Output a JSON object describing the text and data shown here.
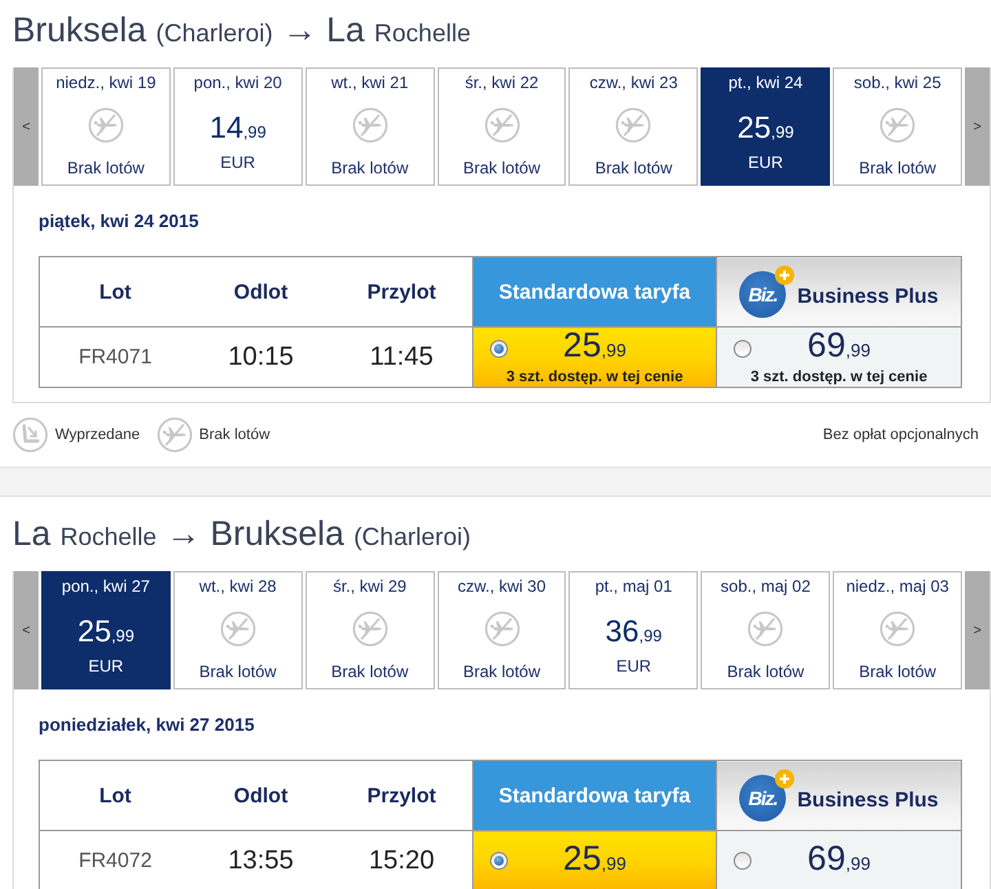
{
  "journeys": [
    {
      "title": {
        "origin": {
          "large": "Bruksela",
          "small": "(Charleroi)"
        },
        "arrow": "→",
        "destination": {
          "large": "La",
          "small": "Rochelle"
        }
      },
      "date_strip": {
        "prev": "<",
        "next": ">",
        "days": [
          {
            "label": "niedz., kwi 19",
            "kind": "no_flights",
            "status": "Brak lotów",
            "selected": false
          },
          {
            "label": "pon., kwi 20",
            "kind": "price",
            "price": {
              "whole": "14",
              "fraction": ",99"
            },
            "currency": "EUR",
            "selected": false
          },
          {
            "label": "wt., kwi 21",
            "kind": "no_flights",
            "status": "Brak lotów",
            "selected": false
          },
          {
            "label": "śr., kwi 22",
            "kind": "no_flights",
            "status": "Brak lotów",
            "selected": false
          },
          {
            "label": "czw., kwi 23",
            "kind": "no_flights",
            "status": "Brak lotów",
            "selected": false
          },
          {
            "label": "pt., kwi 24",
            "kind": "price",
            "price": {
              "whole": "25",
              "fraction": ",99"
            },
            "currency": "EUR",
            "selected": true
          },
          {
            "label": "sob., kwi 25",
            "kind": "no_flights",
            "status": "Brak lotów",
            "selected": false
          }
        ]
      },
      "date_heading": "piątek, kwi 24 2015",
      "table": {
        "columns": [
          "Lot",
          "Odlot",
          "Przylot"
        ],
        "fares": [
          {
            "kind": "standard",
            "label": "Standardowa taryfa"
          },
          {
            "kind": "business",
            "logo": "Biz.",
            "label": "Business Plus"
          }
        ],
        "rows": [
          {
            "flight": "FR4071",
            "departure": "10:15",
            "arrival": "11:45",
            "fares": [
              {
                "selected": true,
                "price": {
                  "whole": "25",
                  "fraction": ",99"
                },
                "availability": "3 szt. dostęp. w tej cenie"
              },
              {
                "selected": false,
                "price": {
                  "whole": "69",
                  "fraction": ",99"
                },
                "availability": "3 szt. dostęp. w tej cenie"
              }
            ]
          }
        ]
      },
      "legend": {
        "items": [
          {
            "kind": "sold_out",
            "label": "Wyprzedane"
          },
          {
            "kind": "no_flights",
            "label": "Brak lotów"
          }
        ],
        "note": "Bez opłat opcjonalnych"
      }
    },
    {
      "title": {
        "origin": {
          "large": "La",
          "small": "Rochelle"
        },
        "arrow": "→",
        "destination": {
          "large": "Bruksela",
          "small": "(Charleroi)"
        }
      },
      "date_strip": {
        "prev": "<",
        "next": ">",
        "days": [
          {
            "label": "pon., kwi 27",
            "kind": "price",
            "price": {
              "whole": "25",
              "fraction": ",99"
            },
            "currency": "EUR",
            "selected": true
          },
          {
            "label": "wt., kwi 28",
            "kind": "no_flights",
            "status": "Brak lotów",
            "selected": false
          },
          {
            "label": "śr., kwi 29",
            "kind": "no_flights",
            "status": "Brak lotów",
            "selected": false
          },
          {
            "label": "czw., kwi 30",
            "kind": "no_flights",
            "status": "Brak lotów",
            "selected": false
          },
          {
            "label": "pt., maj 01",
            "kind": "price",
            "price": {
              "whole": "36",
              "fraction": ",99"
            },
            "currency": "EUR",
            "selected": false
          },
          {
            "label": "sob., maj 02",
            "kind": "no_flights",
            "status": "Brak lotów",
            "selected": false
          },
          {
            "label": "niedz., maj 03",
            "kind": "no_flights",
            "status": "Brak lotów",
            "selected": false
          }
        ]
      },
      "date_heading": "poniedziałek, kwi 27 2015",
      "table": {
        "columns": [
          "Lot",
          "Odlot",
          "Przylot"
        ],
        "fares": [
          {
            "kind": "standard",
            "label": "Standardowa taryfa"
          },
          {
            "kind": "business",
            "logo": "Biz.",
            "label": "Business Plus"
          }
        ],
        "rows": [
          {
            "flight": "FR4072",
            "departure": "13:55",
            "arrival": "15:20",
            "fares": [
              {
                "selected": true,
                "price": {
                  "whole": "25",
                  "fraction": ",99"
                }
              },
              {
                "selected": false,
                "price": {
                  "whole": "69",
                  "fraction": ",99"
                }
              }
            ]
          }
        ]
      }
    }
  ]
}
